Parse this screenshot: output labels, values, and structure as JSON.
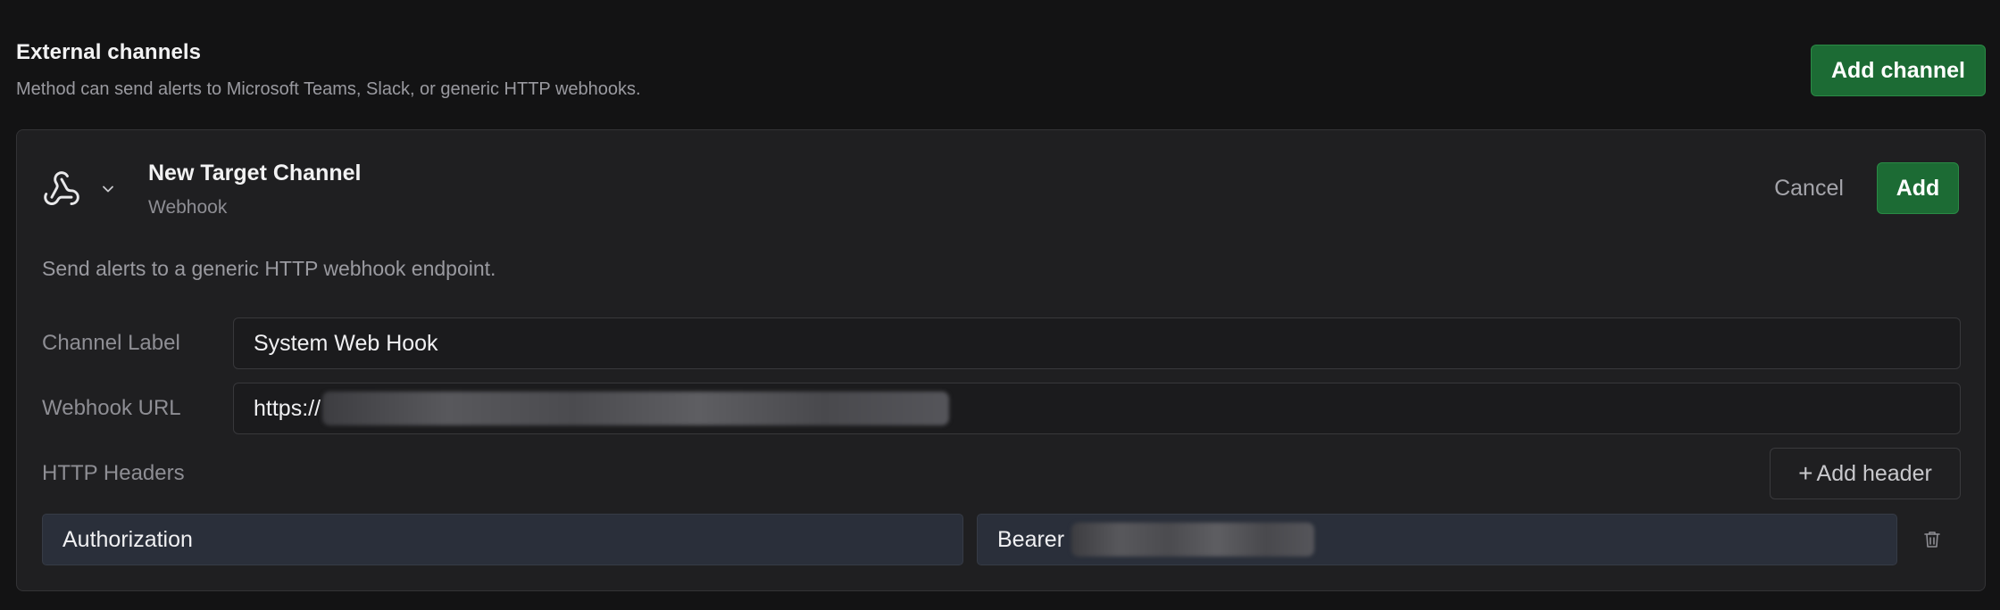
{
  "section": {
    "title": "External channels",
    "subtitle": "Method can send alerts to Microsoft Teams, Slack, or generic HTTP webhooks.",
    "add_channel_label": "Add channel"
  },
  "card": {
    "icon": "webhook-icon",
    "channel_name": "New Target Channel",
    "channel_type": "Webhook",
    "cancel_label": "Cancel",
    "add_label": "Add",
    "description": "Send alerts to a generic HTTP webhook endpoint.",
    "fields": {
      "label": {
        "label": "Channel Label",
        "value": "System Web Hook"
      },
      "url": {
        "label": "Webhook URL",
        "value_prefix": "https://"
      },
      "headers": {
        "label": "HTTP Headers",
        "add_header_label": "Add header",
        "rows": [
          {
            "key": "Authorization",
            "value_prefix": "Bearer"
          }
        ]
      }
    }
  },
  "colors": {
    "background": "#131314",
    "card": "#1f1f21",
    "primary": "#1c6b34",
    "header_input": "#2a2f3a"
  }
}
